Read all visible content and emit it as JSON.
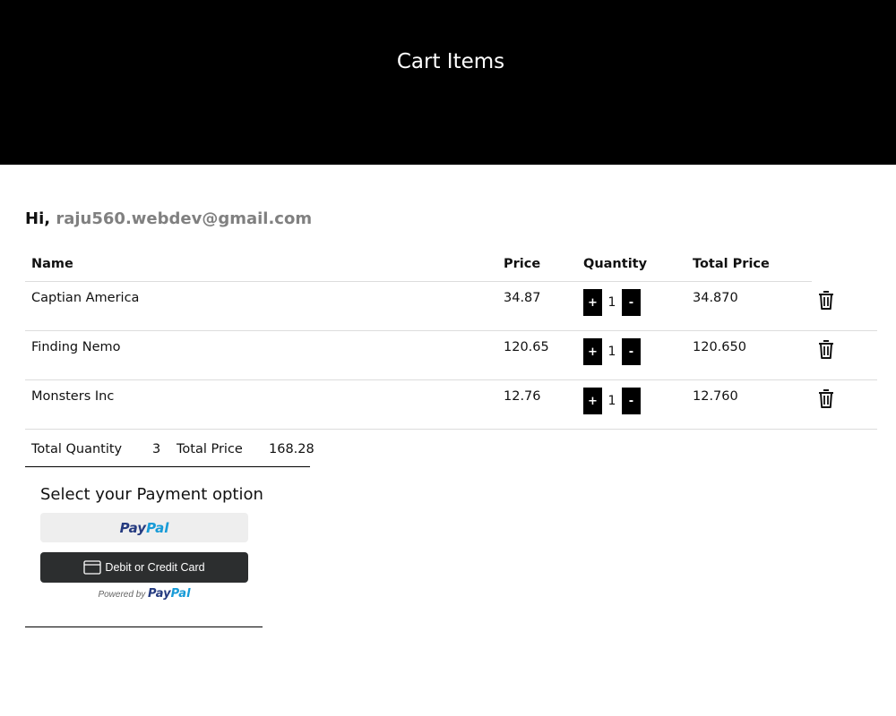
{
  "header": {
    "title": "Cart Items"
  },
  "greeting": {
    "prefix": "Hi,",
    "email": "raju560.webdev@gmail.com"
  },
  "table": {
    "columns": [
      "Name",
      "Price",
      "Quantity",
      "Total Price"
    ],
    "rows": [
      {
        "name": "Captian America",
        "price": "34.87",
        "qty": "1",
        "total": "34.870"
      },
      {
        "name": "Finding Nemo",
        "price": "120.65",
        "qty": "1",
        "total": "120.650"
      },
      {
        "name": "Monsters Inc",
        "price": "12.76",
        "qty": "1",
        "total": "12.760"
      }
    ],
    "plus_label": "+",
    "minus_label": "-"
  },
  "totals": {
    "qty_label": "Total Quantity",
    "qty_value": "3",
    "price_label": "Total Price",
    "price_value": "168.28"
  },
  "payment": {
    "title": "Select your Payment option",
    "paypal_pay": "Pay",
    "paypal_pal": "Pal",
    "card_label": "Debit or Credit Card",
    "powered_by": "Powered by"
  },
  "icons": {
    "delete": "trash-icon",
    "card": "credit-card-icon"
  }
}
